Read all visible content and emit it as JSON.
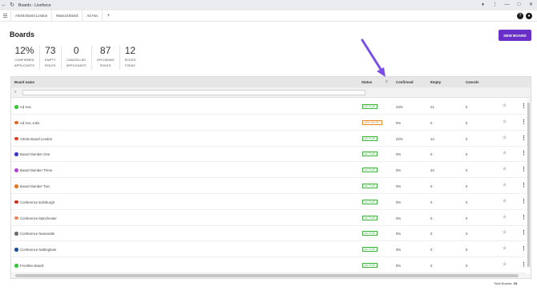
{
  "window": {
    "title": "Boards - Liveforce"
  },
  "tabs": [
    {
      "label": "Artists Board London"
    },
    {
      "label": "Musical Board"
    },
    {
      "label": "Ad Hoc"
    },
    {
      "label": "+"
    }
  ],
  "page": {
    "title": "Boards",
    "new_board_label": "NEW BOARD"
  },
  "stats": [
    {
      "value": "12%",
      "label1": "CONFIRMED",
      "label2": "APPLICANTS"
    },
    {
      "value": "73",
      "label1": "EMPTY",
      "label2": "ROLES"
    },
    {
      "value": "0",
      "label1": "CANCELLED",
      "label2": "APPLICANTS"
    },
    {
      "value": "87",
      "label1": "UPCOMING",
      "label2": "ROLES"
    },
    {
      "value": "12",
      "label1": "ROLES",
      "label2": "TODAY"
    }
  ],
  "table": {
    "columns": {
      "name": "Board name",
      "status": "Status",
      "confirmed": "Confirmed",
      "empty": "Empty",
      "cancels": "Cancels"
    },
    "rows": [
      {
        "name": "Ad Hoc",
        "status": "ACTIVE",
        "confirmed": "23%",
        "empty": "21",
        "cancels": "0",
        "dot": "#3cc43c"
      },
      {
        "name": "Ad Hoc Jobs",
        "status": "ARCHIVED",
        "confirmed": "0%",
        "empty": "0",
        "cancels": "0",
        "dot": "#e06b2a"
      },
      {
        "name": "Artists Board London",
        "status": "ACTIVE",
        "confirmed": "22%",
        "empty": "14",
        "cancels": "0",
        "dot": "#d7452e"
      },
      {
        "name": "Board Number One",
        "status": "ACTIVE",
        "confirmed": "0%",
        "empty": "0",
        "cancels": "0",
        "dot": "#3b39c7"
      },
      {
        "name": "Board Number Three",
        "status": "ACTIVE",
        "confirmed": "0%",
        "empty": "24",
        "cancels": "0",
        "dot": "#b04bd0"
      },
      {
        "name": "Board Number Two",
        "status": "ACTIVE",
        "confirmed": "0%",
        "empty": "0",
        "cancels": "0",
        "dot": "#e07a2a"
      },
      {
        "name": "Conference Edinburgh",
        "status": "ACTIVE",
        "confirmed": "0%",
        "empty": "0",
        "cancels": "0",
        "dot": "#c8331f"
      },
      {
        "name": "Conference Manchester",
        "status": "ACTIVE",
        "confirmed": "0%",
        "empty": "0",
        "cancels": "0",
        "dot": "#e58a64"
      },
      {
        "name": "Conference Newcastle",
        "status": "ACTIVE",
        "confirmed": "0%",
        "empty": "0",
        "cancels": "0",
        "dot": "#6d6d6d"
      },
      {
        "name": "Conference Nottingham",
        "status": "ACTIVE",
        "confirmed": "0%",
        "empty": "0",
        "cancels": "0",
        "dot": "#1d4f93"
      },
      {
        "name": "Frontline Board",
        "status": "ACTIVE",
        "confirmed": "0%",
        "empty": "0",
        "cancels": "0",
        "dot": "#3cc43c"
      }
    ]
  },
  "footer": {
    "label": "Total Boards:",
    "value": "19"
  },
  "colors": {
    "accent": "#6a2fc9",
    "active": "#3cb43c",
    "archived": "#e8892a",
    "arrow": "#7b4fe6"
  },
  "icons": {
    "back": "arrow-left-icon",
    "reload": "reload-icon",
    "menu": "hamburger-icon",
    "filter": "filter-icon",
    "star": "star-icon",
    "kebab": "kebab-icon",
    "sort": "sort-icon"
  }
}
